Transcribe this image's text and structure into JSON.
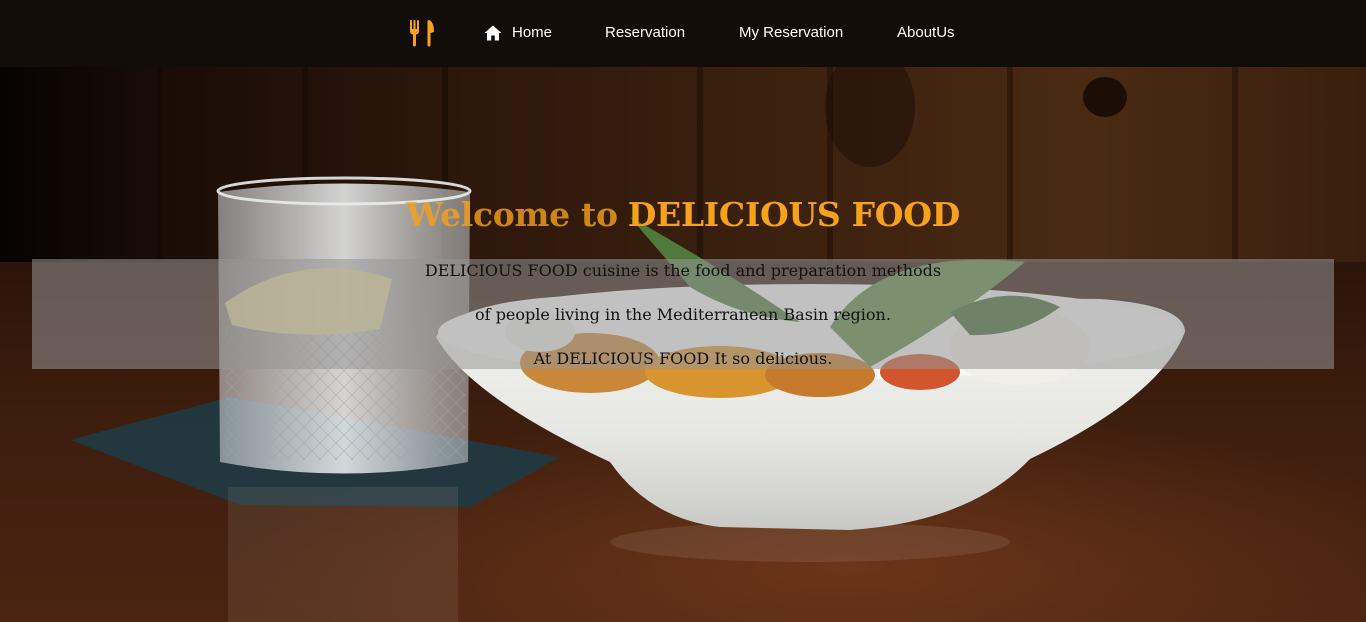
{
  "nav": {
    "logo_icon": "fork-knife-icon",
    "home_icon": "home-icon",
    "links": [
      "Home",
      "Reservation",
      "My Reservation",
      "AboutUs"
    ],
    "accent": "#f7a21b"
  },
  "hero": {
    "welcome": "Welcome to",
    "brand": "DELICIOUS FOOD",
    "lines": [
      "DELICIOUS FOOD cuisine is the food and preparation methods",
      "of people living in the Mediterranean Basin region.",
      "At DELICIOUS FOOD It so delicious."
    ],
    "accent": "#f7a21b"
  }
}
